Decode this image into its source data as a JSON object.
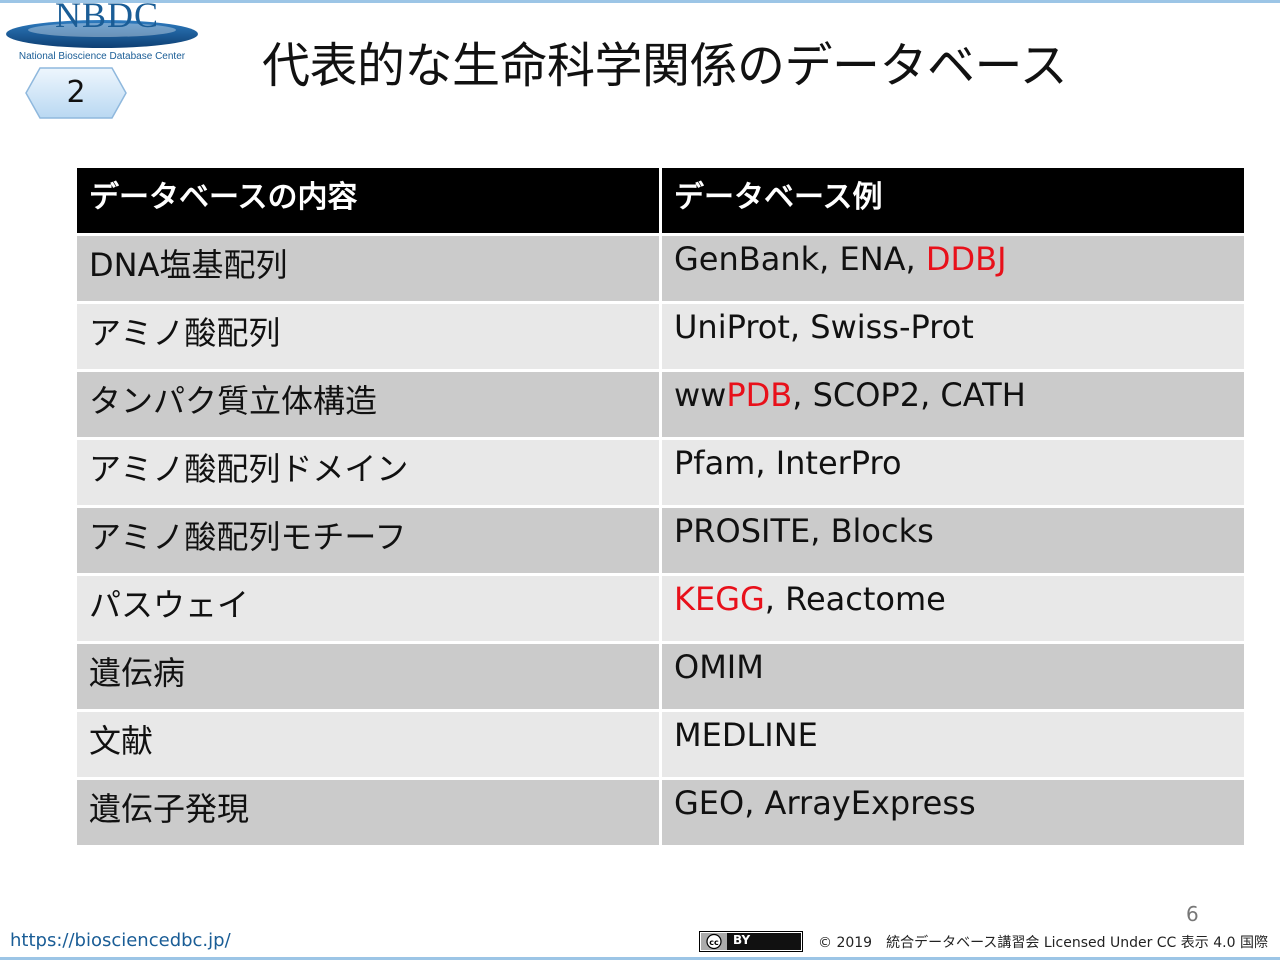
{
  "logo": {
    "text": "NBDC",
    "subtitle": "National Bioscience Database Center"
  },
  "badge": {
    "number": "2"
  },
  "title": "代表的な生命科学関係のデータベース",
  "table": {
    "headers": {
      "content": "データベースの内容",
      "examples": "データベース例"
    },
    "rows": [
      {
        "content": "DNA塩基配列",
        "examples": [
          {
            "text": "GenBank, ENA, "
          },
          {
            "text": "DDBJ",
            "highlight": true
          }
        ]
      },
      {
        "content": "アミノ酸配列",
        "examples": [
          {
            "text": "UniProt, Swiss-Prot"
          }
        ]
      },
      {
        "content": "タンパク質立体構造",
        "examples": [
          {
            "text": "ww"
          },
          {
            "text": "PDB",
            "highlight": true
          },
          {
            "text": ", SCOP2, CATH"
          }
        ]
      },
      {
        "content": "アミノ酸配列ドメイン",
        "examples": [
          {
            "text": "Pfam, InterPro"
          }
        ]
      },
      {
        "content": "アミノ酸配列モチーフ",
        "examples": [
          {
            "text": "PROSITE, Blocks"
          }
        ]
      },
      {
        "content": "パスウェイ",
        "examples": [
          {
            "text": "KEGG",
            "highlight": true
          },
          {
            "text": ", Reactome"
          }
        ]
      },
      {
        "content": "遺伝病",
        "examples": [
          {
            "text": "OMIM"
          }
        ]
      },
      {
        "content": "文献",
        "examples": [
          {
            "text": "MEDLINE"
          }
        ]
      },
      {
        "content": "遺伝子発現",
        "examples": [
          {
            "text": "GEO, ArrayExpress"
          }
        ]
      }
    ]
  },
  "footer": {
    "page_number": "6",
    "url": "https://biosciencedbc.jp/",
    "cc_label": "BY",
    "license": "© 2019　統合データベース講習会 Licensed Under CC 表示 4.0 国際"
  },
  "colors": {
    "highlight": "#e8101a",
    "logo": "#1a5d96",
    "header_bg": "#000000",
    "row_dark": "#cbcbcb",
    "row_light": "#e8e8e8"
  }
}
